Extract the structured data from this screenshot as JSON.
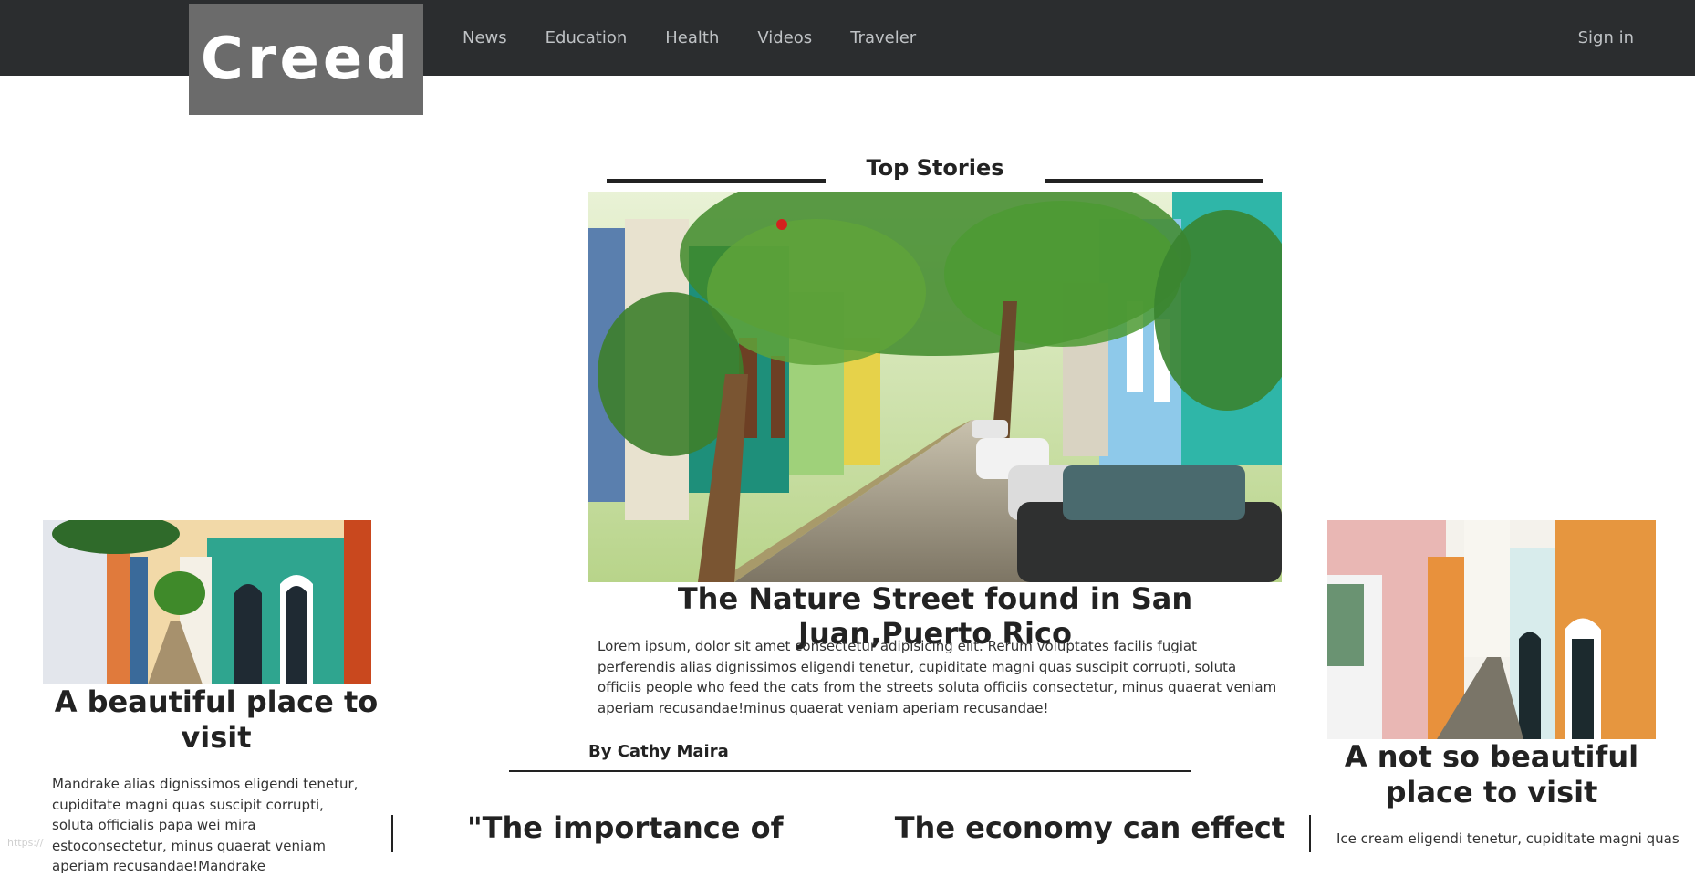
{
  "brand": {
    "logo_text": "Creed"
  },
  "nav": {
    "links": [
      "News",
      "Education",
      "Health",
      "Videos",
      "Traveler"
    ],
    "signin_label": "Sign in"
  },
  "top_stories": {
    "heading": "Top Stories",
    "main": {
      "title": "The Nature Street found in San Juan,Puerto Rico",
      "body": "Lorem ipsum, dolor sit amet consectetur adipisicing elit. Rerum voluptates facilis fugiat perferendis alias dignissimos eligendi tenetur, cupiditate magni quas suscipit corrupti, soluta officiis people who feed the cats from the streets soluta officiis consectetur, minus quaerat veniam aperiam recusandae!minus quaerat veniam aperiam recusandae!",
      "byline": "By Cathy Maira"
    },
    "left": {
      "title": "A beautiful place to visit",
      "body": "Mandrake alias dignissimos eligendi tenetur, cupiditate magni quas suscipit corrupti, soluta officialis papa wei mira estoconsectetur, minus quaerat veniam aperiam recusandae!Mandrake"
    },
    "right": {
      "title": "A not so beautiful place to visit",
      "body": "Ice cream eligendi tenetur, cupiditate magni quas"
    }
  },
  "lower": {
    "left_title": "\"The importance of",
    "right_title": "The economy can effect"
  },
  "status_url": "https://"
}
